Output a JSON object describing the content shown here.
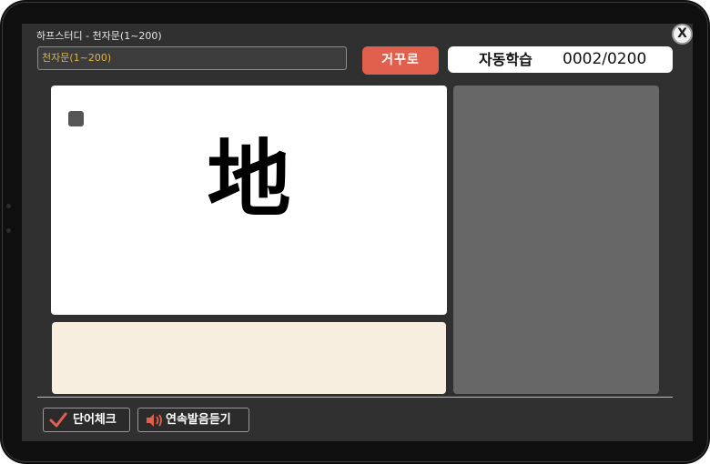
{
  "window": {
    "title": "하프스터디 - 천자문(1~200)",
    "close_label": "X"
  },
  "search": {
    "value": "천자문(1~200)"
  },
  "toolbar": {
    "reverse_label": "거꾸로",
    "auto_label": "자동학습",
    "counter": "0002/0200"
  },
  "card": {
    "hanja": "地"
  },
  "bottom": {
    "word_check_label": "단어체크",
    "continuous_label": "연속발음듣기"
  },
  "colors": {
    "accent": "#e0604d",
    "search_text": "#d9b44a",
    "background": "#303030",
    "meaning_panel": "#f7eee0",
    "side_panel": "#676767"
  },
  "icons": {
    "check": "checkmark-icon",
    "speaker": "speaker-icon",
    "close": "close-icon"
  }
}
